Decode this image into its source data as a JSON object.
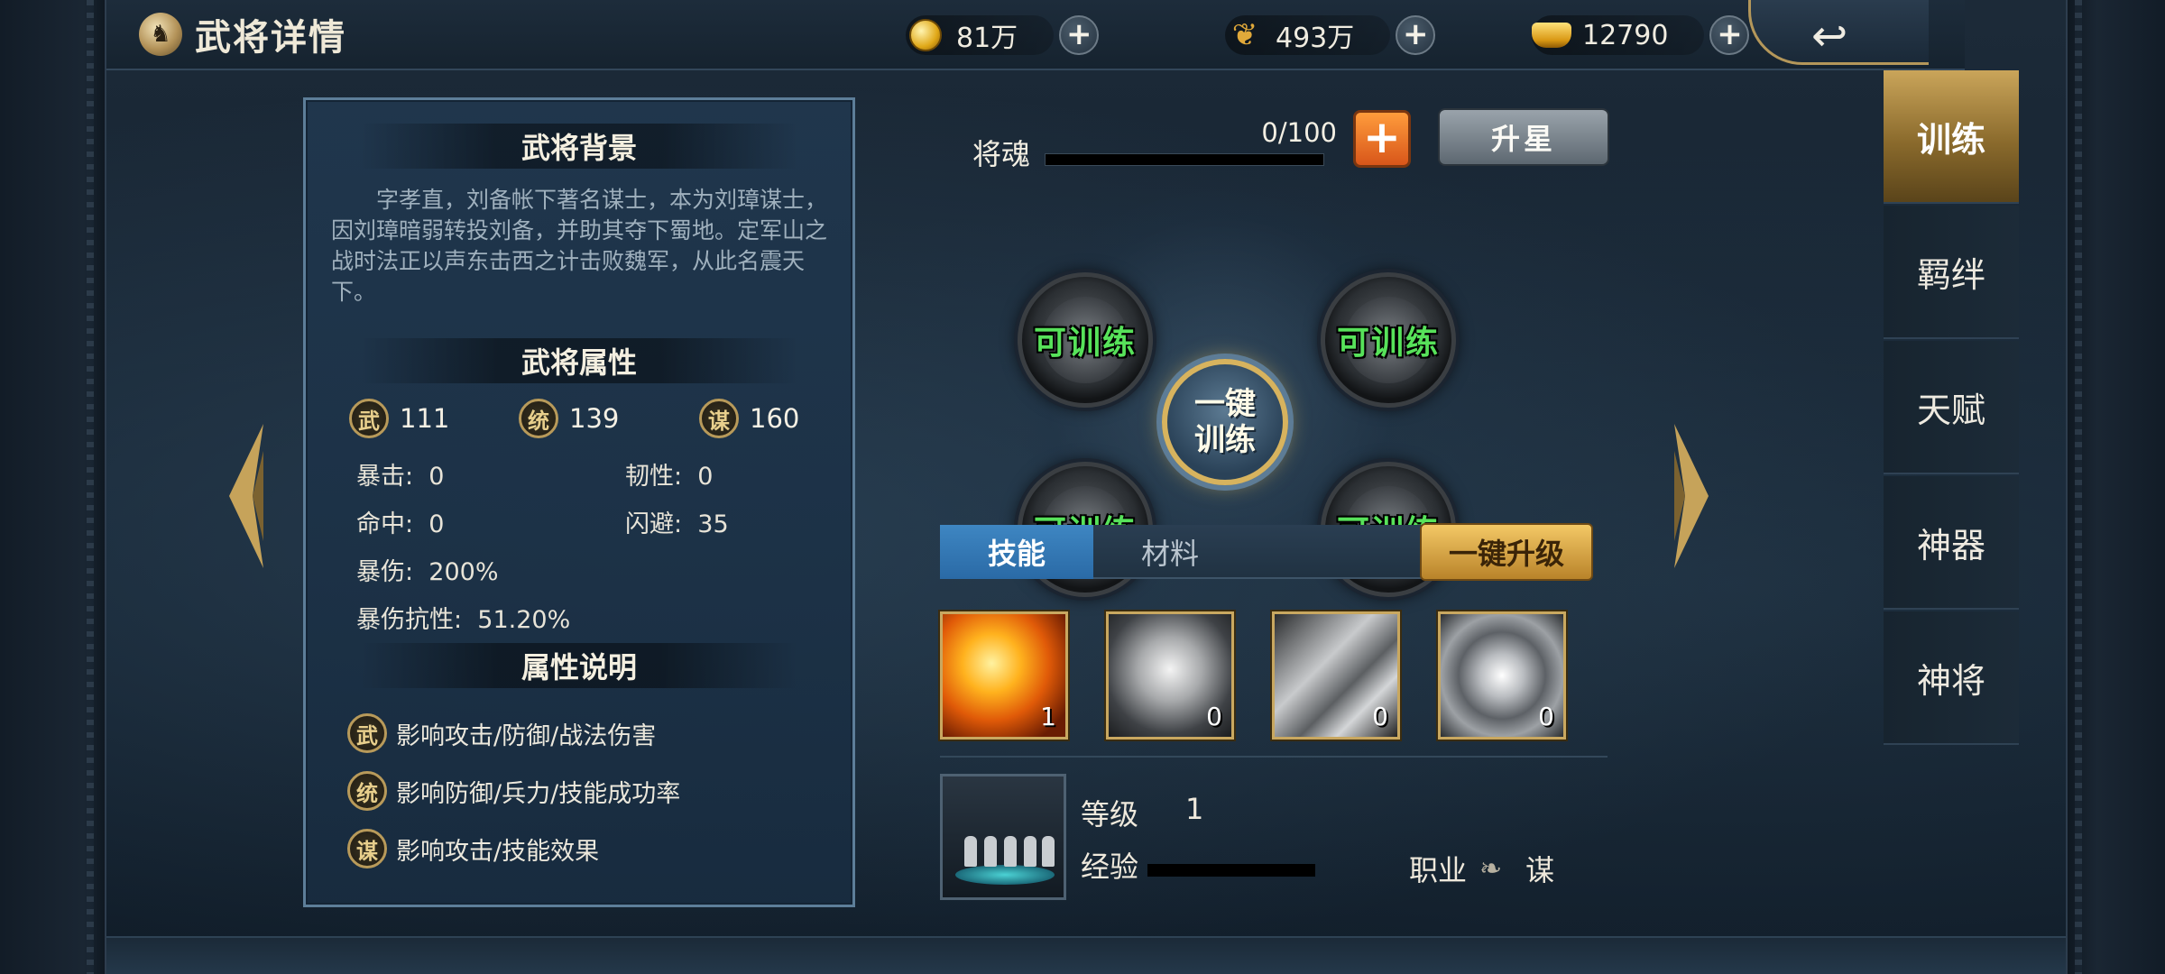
{
  "header": {
    "title": "武将详情",
    "resources": [
      {
        "name": "coin",
        "icon": "coin-icon",
        "value": "81万"
      },
      {
        "name": "grain",
        "icon": "feather-icon",
        "value": "493万"
      },
      {
        "name": "gold",
        "icon": "ingot-icon",
        "value": "12790"
      }
    ],
    "plus_symbol": "+"
  },
  "bio": {
    "title": "武将背景",
    "text": "字孝直，刘备帐下著名谋士，本为刘璋谋士，因刘璋暗弱转投刘备，并助其夺下蜀地。定军山之战时法正以声东击西之计击败魏军，从此名震天下。"
  },
  "attributes": {
    "title": "武将属性",
    "main": [
      {
        "badge": "武",
        "value": "111"
      },
      {
        "badge": "统",
        "value": "139"
      },
      {
        "badge": "谋",
        "value": "160"
      }
    ],
    "lines": [
      {
        "label": "暴击:",
        "value": "0"
      },
      {
        "label": "韧性:",
        "value": "0"
      },
      {
        "label": "命中:",
        "value": "0"
      },
      {
        "label": "闪避:",
        "value": "35"
      },
      {
        "label": "暴伤:",
        "value": "200%"
      },
      {
        "label": "暴伤抗性:",
        "value": "51.20%"
      }
    ]
  },
  "attr_desc": {
    "title": "属性说明",
    "items": [
      {
        "badge": "武",
        "text": "影响攻击/防御/战法伤害"
      },
      {
        "badge": "统",
        "text": "影响防御/兵力/技能成功率"
      },
      {
        "badge": "谋",
        "text": "影响攻击/技能效果"
      }
    ]
  },
  "soul": {
    "label": "将魂",
    "value": "0/100",
    "progress_fraction": 0,
    "plus_symbol": "+",
    "star_button": "升星"
  },
  "training": {
    "slots": [
      "可训练",
      "可训练",
      "可训练",
      "可训练"
    ],
    "center_line1": "一键",
    "center_line2": "训练"
  },
  "tabs": {
    "items": [
      "技能",
      "材料"
    ],
    "active": 0,
    "upgrade_button": "一键升级"
  },
  "skills": [
    {
      "icon": "fire-sword-skill-icon",
      "level": "1"
    },
    {
      "icon": "figure-heal-skill-icon",
      "level": "0"
    },
    {
      "icon": "blade-skill-icon",
      "level": "0"
    },
    {
      "icon": "vortex-skill-icon",
      "level": "0"
    }
  ],
  "troop": {
    "level_label": "等级",
    "level_value": "1",
    "exp_label": "经验",
    "exp_fraction": 0,
    "job_label": "职业",
    "job_icon": "leaf-icon",
    "job_value": "谋"
  },
  "side_tabs": {
    "items": [
      "训练",
      "羁绊",
      "天赋",
      "神器",
      "神将"
    ],
    "active": 0
  },
  "colors": {
    "trainable_green": "#57e25a",
    "gold_accent": "#c9a860",
    "active_tab_blue": "#3e86c2"
  }
}
